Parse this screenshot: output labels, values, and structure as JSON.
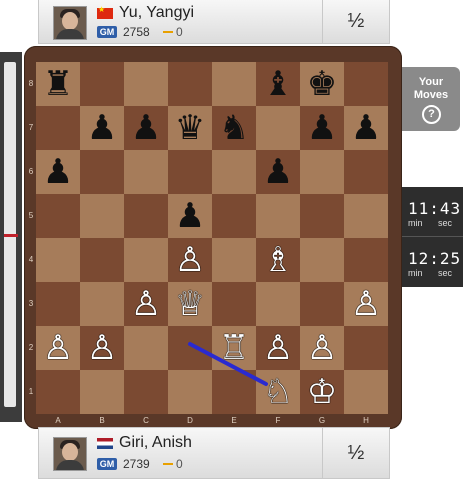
{
  "top_player": {
    "name": "Yu, Yangyi",
    "title": "GM",
    "rating": "2758",
    "rating_change": "0",
    "score": "½",
    "flag": "flag-china-icon"
  },
  "bottom_player": {
    "name": "Giri, Anish",
    "title": "GM",
    "rating": "2739",
    "rating_change": "0",
    "score": "½",
    "flag": "flag-netherlands-icon"
  },
  "your_moves": {
    "line1": "Your",
    "line2": "Moves",
    "help": "?"
  },
  "clocks": [
    {
      "time": "11:43",
      "unit_min": "min",
      "unit_sec": "sec"
    },
    {
      "time": "12:25",
      "unit_min": "min",
      "unit_sec": "sec"
    }
  ],
  "board": {
    "files": [
      "A",
      "B",
      "C",
      "D",
      "E",
      "F",
      "G",
      "H"
    ],
    "ranks": [
      "8",
      "7",
      "6",
      "5",
      "4",
      "3",
      "2",
      "1"
    ],
    "light_square": "#a67c5a",
    "dark_square": "#7b4a32",
    "arrow_color": "#2a2ad0",
    "arrow": {
      "from": "d2",
      "to": "f1"
    },
    "pieces": [
      {
        "square": "a8",
        "color": "b",
        "type": "rook"
      },
      {
        "square": "f8",
        "color": "b",
        "type": "bishop"
      },
      {
        "square": "g8",
        "color": "b",
        "type": "king"
      },
      {
        "square": "b7",
        "color": "b",
        "type": "pawn"
      },
      {
        "square": "c7",
        "color": "b",
        "type": "pawn"
      },
      {
        "square": "d7",
        "color": "b",
        "type": "queen"
      },
      {
        "square": "e7",
        "color": "b",
        "type": "knight"
      },
      {
        "square": "g7",
        "color": "b",
        "type": "pawn"
      },
      {
        "square": "h7",
        "color": "b",
        "type": "pawn"
      },
      {
        "square": "a6",
        "color": "b",
        "type": "pawn"
      },
      {
        "square": "f6",
        "color": "b",
        "type": "pawn"
      },
      {
        "square": "d5",
        "color": "b",
        "type": "pawn"
      },
      {
        "square": "d4",
        "color": "w",
        "type": "pawn"
      },
      {
        "square": "f4",
        "color": "w",
        "type": "bishop"
      },
      {
        "square": "c3",
        "color": "w",
        "type": "pawn"
      },
      {
        "square": "d3",
        "color": "w",
        "type": "queen"
      },
      {
        "square": "h3",
        "color": "w",
        "type": "pawn"
      },
      {
        "square": "a2",
        "color": "w",
        "type": "pawn"
      },
      {
        "square": "b2",
        "color": "w",
        "type": "pawn"
      },
      {
        "square": "e2",
        "color": "w",
        "type": "rook"
      },
      {
        "square": "f2",
        "color": "w",
        "type": "pawn"
      },
      {
        "square": "g2",
        "color": "w",
        "type": "pawn"
      },
      {
        "square": "f1",
        "color": "w",
        "type": "knight"
      },
      {
        "square": "g1",
        "color": "w",
        "type": "king"
      }
    ]
  }
}
